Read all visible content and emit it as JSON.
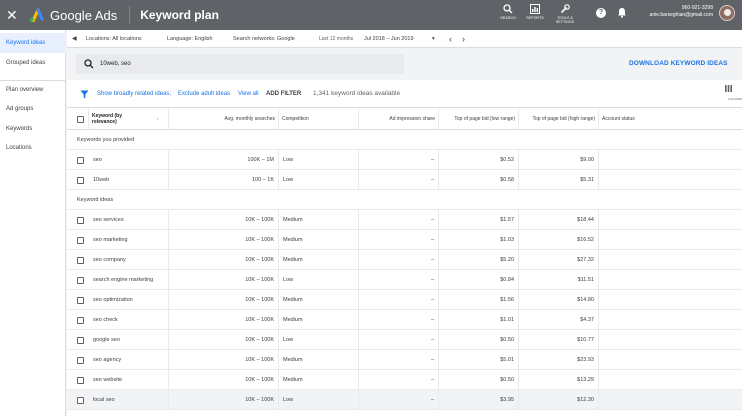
{
  "topbar": {
    "close": "✕",
    "brand": "Google Ads",
    "page_title": "Keyword plan",
    "tools": [
      {
        "label": "SEARCH",
        "icon": "search-icon"
      },
      {
        "label": "REPORTS",
        "icon": "reports-icon"
      },
      {
        "label": "TOOLS & SETTINGS",
        "icon": "wrench-icon"
      }
    ],
    "account_id": "960-921-3298",
    "account_email": "anie.barseghian@gmail.com"
  },
  "sidebar": {
    "items": [
      {
        "label": "Keyword ideas",
        "active": true
      },
      {
        "label": "Grouped ideas",
        "active": false
      },
      {
        "label": "Plan overview",
        "active": false
      },
      {
        "label": "Ad groups",
        "active": false
      },
      {
        "label": "Keywords",
        "active": false
      },
      {
        "label": "Locations",
        "active": false
      }
    ]
  },
  "filterbar": {
    "collapse": "◀",
    "locations": "Locations: All locations",
    "language": "Language: English",
    "networks": "Search networks: Google",
    "period_label": "Last 12 months",
    "period_value": "Jul 2018 – Jun 2019",
    "dropdown": "▾",
    "prev": "‹",
    "next": "›"
  },
  "search": {
    "query": "10web, seo",
    "download_label": "DOWNLOAD KEYWORD IDEAS"
  },
  "ideas": {
    "broad": "Show broadly related ideas;",
    "exclude": "Exclude adult ideas",
    "view_all": "View all",
    "add_filter": "ADD FILTER",
    "count": "1,341 keyword ideas available",
    "columns_label": "COLUMNS"
  },
  "table": {
    "headers": {
      "keyword": "Keyword (by relevance)",
      "searches": "Avg. monthly searches",
      "competition": "Competition",
      "impression": "Ad impression share",
      "bid_low": "Top of page bid (low range)",
      "bid_high": "Top of page bid (high range)",
      "status": "Account status"
    },
    "section_provided": "Keywords you provided",
    "section_ideas": "Keyword ideas",
    "provided": [
      {
        "keyword": "seo",
        "searches": "100K – 1M",
        "competition": "Low",
        "impression": "–",
        "bid_low": "$0.52",
        "bid_high": "$9.00"
      },
      {
        "keyword": "10web",
        "searches": "100 – 1K",
        "competition": "Low",
        "impression": "–",
        "bid_low": "$0.58",
        "bid_high": "$5.31"
      }
    ],
    "ideas": [
      {
        "keyword": "seo services",
        "searches": "10K – 100K",
        "competition": "Medium",
        "impression": "–",
        "bid_low": "$1.57",
        "bid_high": "$18.44"
      },
      {
        "keyword": "seo marketing",
        "searches": "10K – 100K",
        "competition": "Medium",
        "impression": "–",
        "bid_low": "$1.03",
        "bid_high": "$16.52"
      },
      {
        "keyword": "seo company",
        "searches": "10K – 100K",
        "competition": "Medium",
        "impression": "–",
        "bid_low": "$5.20",
        "bid_high": "$27.32"
      },
      {
        "keyword": "search engine marketing",
        "searches": "10K – 100K",
        "competition": "Low",
        "impression": "–",
        "bid_low": "$0.84",
        "bid_high": "$11.51"
      },
      {
        "keyword": "seo optimization",
        "searches": "10K – 100K",
        "competition": "Medium",
        "impression": "–",
        "bid_low": "$1.56",
        "bid_high": "$14.80"
      },
      {
        "keyword": "seo check",
        "searches": "10K – 100K",
        "competition": "Medium",
        "impression": "–",
        "bid_low": "$1.01",
        "bid_high": "$4.37"
      },
      {
        "keyword": "google seo",
        "searches": "10K – 100K",
        "competition": "Low",
        "impression": "–",
        "bid_low": "$0.50",
        "bid_high": "$10.77"
      },
      {
        "keyword": "seo agency",
        "searches": "10K – 100K",
        "competition": "Medium",
        "impression": "–",
        "bid_low": "$5.01",
        "bid_high": "$23.93"
      },
      {
        "keyword": "seo website",
        "searches": "10K – 100K",
        "competition": "Medium",
        "impression": "–",
        "bid_low": "$0.50",
        "bid_high": "$13.29"
      },
      {
        "keyword": "local seo",
        "searches": "10K – 100K",
        "competition": "Low",
        "impression": "–",
        "bid_low": "$3.95",
        "bid_high": "$12.30"
      }
    ]
  },
  "colors": {
    "topbar": "#5f6368",
    "accent": "#1a73e8",
    "sidebar_active_bg": "#e8f0fe"
  }
}
